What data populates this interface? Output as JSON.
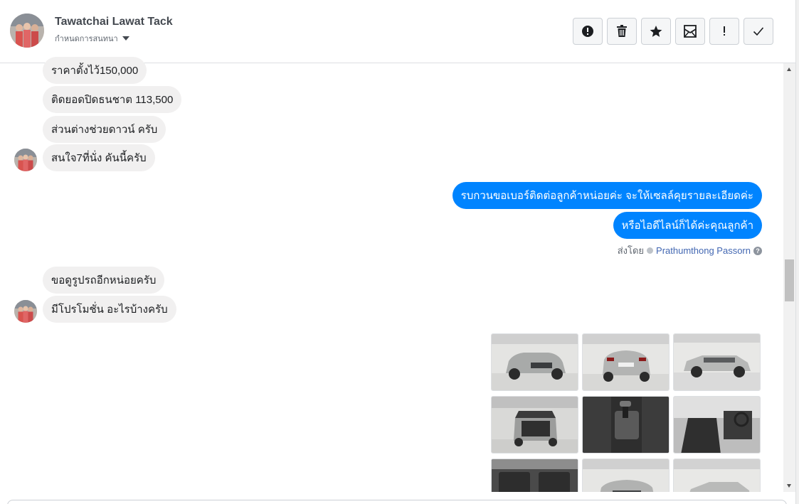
{
  "header": {
    "contact_name": "Tawatchai Lawat Tack",
    "conversation_label": "กำหนดการสนทนา"
  },
  "toolbar": {
    "buttons": [
      {
        "name": "alert-circle-icon"
      },
      {
        "name": "trash-icon"
      },
      {
        "name": "star-icon"
      },
      {
        "name": "mark-unread-icon"
      },
      {
        "name": "exclamation-icon"
      },
      {
        "name": "check-icon"
      }
    ]
  },
  "messages": [
    {
      "dir": "in",
      "text": "ราคาตั้งไว้150,000"
    },
    {
      "dir": "in",
      "text": "ติดยอดปิดธนชาต 113,500"
    },
    {
      "dir": "in",
      "text": "ส่วนต่างช่วยดาวน์ ครับ"
    },
    {
      "dir": "in",
      "text": "สนใจ7ที่นั่ง คันนี้ครับ"
    },
    {
      "dir": "out",
      "text": "รบกวนขอเบอร์ติดต่อลูกค้าหน่อยค่ะ จะให้เซลล์คุยรายละเอียดค่ะ"
    },
    {
      "dir": "out",
      "text": "หรือไอดีไลน์ก็ได้ค่ะคุณลูกค้า"
    },
    {
      "dir": "in",
      "text": "ขอดูรูปรถอีกหน่อยครับ"
    },
    {
      "dir": "in",
      "text": "มีโปรโมชั่น อะไรบ้างครับ"
    }
  ],
  "sent_by": {
    "label": "ส่งโดย",
    "name": "Prathumthong Passorn"
  },
  "photos": [
    {
      "desc": "suv-front-left"
    },
    {
      "desc": "suv-rear"
    },
    {
      "desc": "suv-side"
    },
    {
      "desc": "suv-trunk-open"
    },
    {
      "desc": "gear-console"
    },
    {
      "desc": "driver-seat"
    },
    {
      "desc": "rear-seats"
    },
    {
      "desc": "suv-front"
    },
    {
      "desc": "suv-front-right"
    }
  ],
  "colors": {
    "outgoing_bubble": "#0084ff",
    "incoming_bubble": "#f1f0f0",
    "link": "#4267b2"
  }
}
